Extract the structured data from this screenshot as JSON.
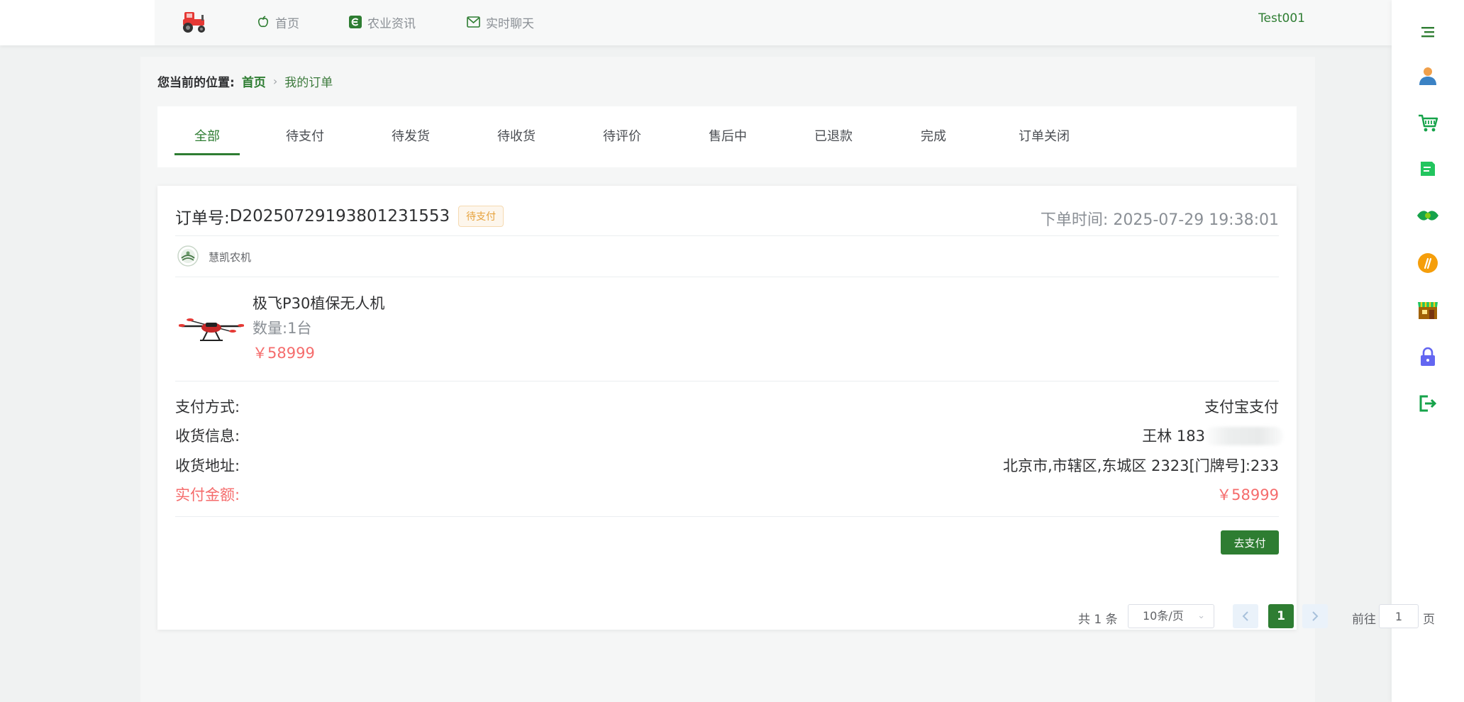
{
  "nav": {
    "items": [
      {
        "label": "首页",
        "icon": "apple-icon"
      },
      {
        "label": "农业资讯",
        "icon": "news-icon"
      },
      {
        "label": "实时聊天",
        "icon": "mail-icon"
      }
    ],
    "user": "Test001"
  },
  "breadcrumb": {
    "label": "您当前的位置:",
    "home": "首页",
    "current": "我的订单"
  },
  "tabs": [
    "全部",
    "待支付",
    "待发货",
    "待收货",
    "待评价",
    "售后中",
    "已退款",
    "完成",
    "订单关闭"
  ],
  "active_tab": "全部",
  "order": {
    "number_label": "订单号:",
    "number": "D20250729193801231553",
    "status": "待支付",
    "time_label": "下单时间:",
    "time": "2025-07-29 19:38:01",
    "shop_name": "慧凯农机",
    "product": {
      "name": "极飞P30植保无人机",
      "quantity": "数量:1台",
      "price": "￥58999"
    },
    "payment_method_label": "支付方式:",
    "payment_method": "支付宝支付",
    "receiver_label": "收货信息:",
    "receiver": "王林 183",
    "address_label": "收货地址:",
    "address": "北京市,市辖区,东城区 2323[门牌号]:233",
    "paid_label": "实付金额:",
    "paid": "￥58999",
    "pay_button": "去支付"
  },
  "pagination": {
    "total": "共 1 条",
    "page_size": "10条/页",
    "current": "1",
    "goto_label": "前往",
    "goto_value": "1",
    "page_suffix": "页"
  },
  "side_toolbar": [
    "menu-icon",
    "user-icon",
    "cart-icon",
    "document-icon",
    "handshake-icon",
    "wheat-icon",
    "store-icon",
    "lock-icon",
    "logout-icon"
  ],
  "colors": {
    "primary": "#2e7d32",
    "price": "#f56c6c",
    "status_badge": "#e6a23c"
  }
}
